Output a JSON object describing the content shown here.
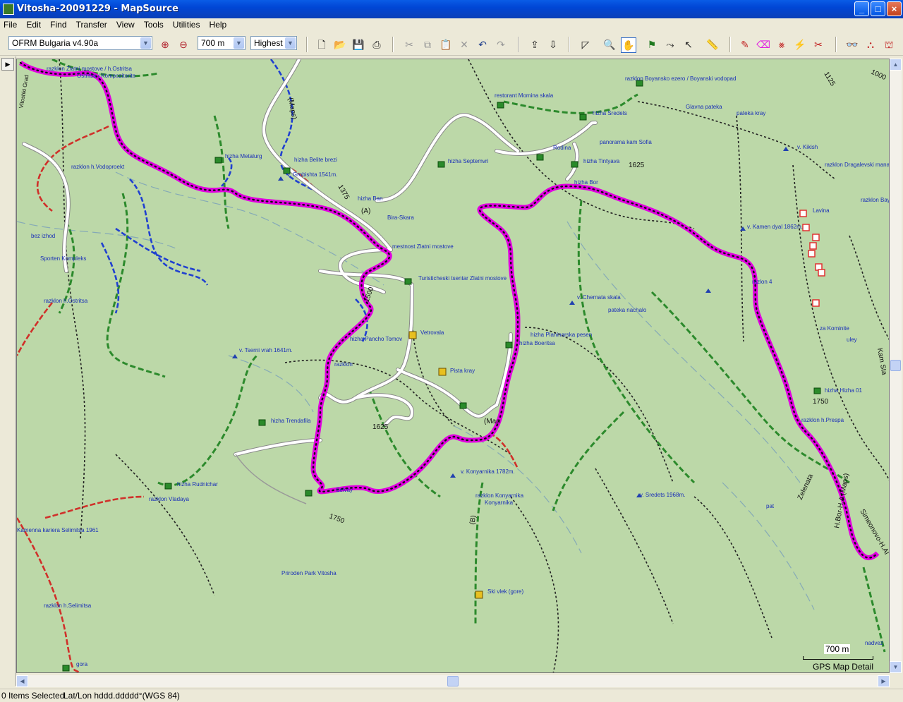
{
  "window": {
    "title": "Vitosha-20091229 - MapSource",
    "minimize": "_",
    "maximize": "□",
    "close": "×"
  },
  "menu": [
    "File",
    "Edit",
    "Find",
    "Transfer",
    "View",
    "Tools",
    "Utilities",
    "Help"
  ],
  "toolbar": {
    "map_product": "OFRM Bulgaria v4.90a",
    "zoom_level": "700 m",
    "detail_level": "Highest"
  },
  "map": {
    "labels": [
      "razklon Zlatni mostove / h.Ostritsa",
      "Ostritsa / Kompozitorite",
      "razklon h.Vodoproekt",
      "hizha Metalurg",
      "hizha Belite brezi",
      "v. Grobishta 1541m.",
      "hizha Ban",
      "Bira-Skara",
      "restorant Momina skala",
      "hizha Sredets",
      "razklon Boyansko ezero / Boyanski vodopad",
      "Glavna pateka",
      "pateka kray",
      "panorama kam Sofia",
      "Rodina",
      "hizha Septemvri",
      "hizha Tintyava",
      "hizha Bor",
      "v. Kikish",
      "razklon Dragalevski manastir",
      "razklon Bay",
      "Lavina",
      "v. Kamen dyal 1862m.",
      "mestnost Zlatni mostove",
      "Turisticheski tsentar Zlatni mostove",
      "razlon 4",
      "v. Chernata skala",
      "pateka nachalo",
      "hizha Planinarska pesen",
      "hizha Boeritsa",
      "za Kominite",
      "uley",
      "bez izhod",
      "Sporten Kompleks",
      "razklon h.Ostritsa",
      "hizha Pancho Tomov",
      "Vetrovala",
      "Pista kray",
      "v. Tserni vrah 1641m.",
      "razklon",
      "hizha Hizha 01",
      "razklon h.Prespa",
      "hizha Trendafila",
      "hizha Rudnichar",
      "razklon Vladaya",
      "Kamenna kariera Selimitsa 1961",
      "v. Konyarnika 1782m.",
      "razklon Konyarnika",
      "Konyarnika",
      "v. Sredets 1968m.",
      "pat",
      "Selvay",
      "Priroden Park Vitosha",
      "razklon h.Selimitsa",
      "Ski vlek (gore)",
      "gora",
      "nadvez",
      "Vitoshki Grad",
      "Kam Sta",
      "Zelenata",
      "H.Bor-H.A (Maps)",
      "Simeonovo-H.Al",
      "(Maps)",
      "(A)",
      "(B)",
      "(Map"
    ],
    "elevations": [
      "1625",
      "1750",
      "1625",
      "1750",
      "1375",
      "1500",
      "1125",
      "1000"
    ],
    "scale_label": "700 m",
    "detail_caption": "GPS Map Detail"
  },
  "statusbar": {
    "selection": "0 Items Selected",
    "coords_format": "Lat/Lon hddd.ddddd°(WGS 84)"
  }
}
